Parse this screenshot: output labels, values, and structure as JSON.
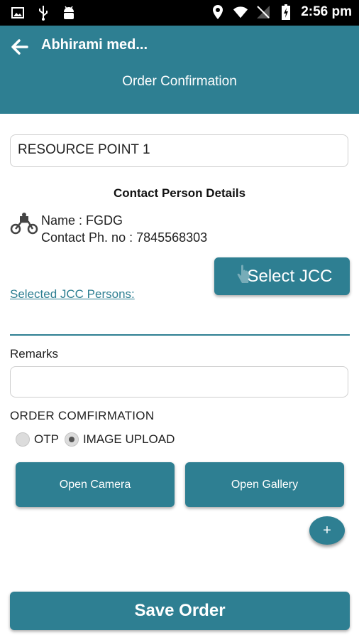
{
  "status_bar": {
    "time": "2:56 pm",
    "left_icons": [
      "image-icon",
      "usb-icon",
      "android-icon"
    ],
    "right_icons": [
      "location-icon",
      "wifi-icon",
      "no-signal-icon",
      "battery-icon"
    ]
  },
  "app_bar": {
    "back_icon": "arrow-left-icon",
    "title": "Abhirami med...",
    "subtitle": "Order Confirmation"
  },
  "form": {
    "resource_point_value": "RESOURCE POINT 1",
    "contact_heading": "Contact Person Details",
    "contact_icon": "motorbike-icon",
    "contact_name": "Name : FGDG",
    "contact_phone": "Contact Ph. no : 7845568303",
    "select_jcc_label": "Select JCC",
    "selected_jcc_link": "Selected JCC Persons:",
    "remarks_label": "Remarks",
    "remarks_value": "",
    "order_confirmation_label": "ORDER COMFIRMATION",
    "radio_options": [
      {
        "label": "OTP",
        "checked": false
      },
      {
        "label": "IMAGE UPLOAD",
        "checked": true
      }
    ],
    "open_camera_label": "Open Camera",
    "open_gallery_label": "Open Gallery",
    "add_label": "+",
    "save_label": "Save Order"
  },
  "colors": {
    "primary": "#2e7f92",
    "status_bar": "#000000",
    "background": "#ffffff"
  }
}
